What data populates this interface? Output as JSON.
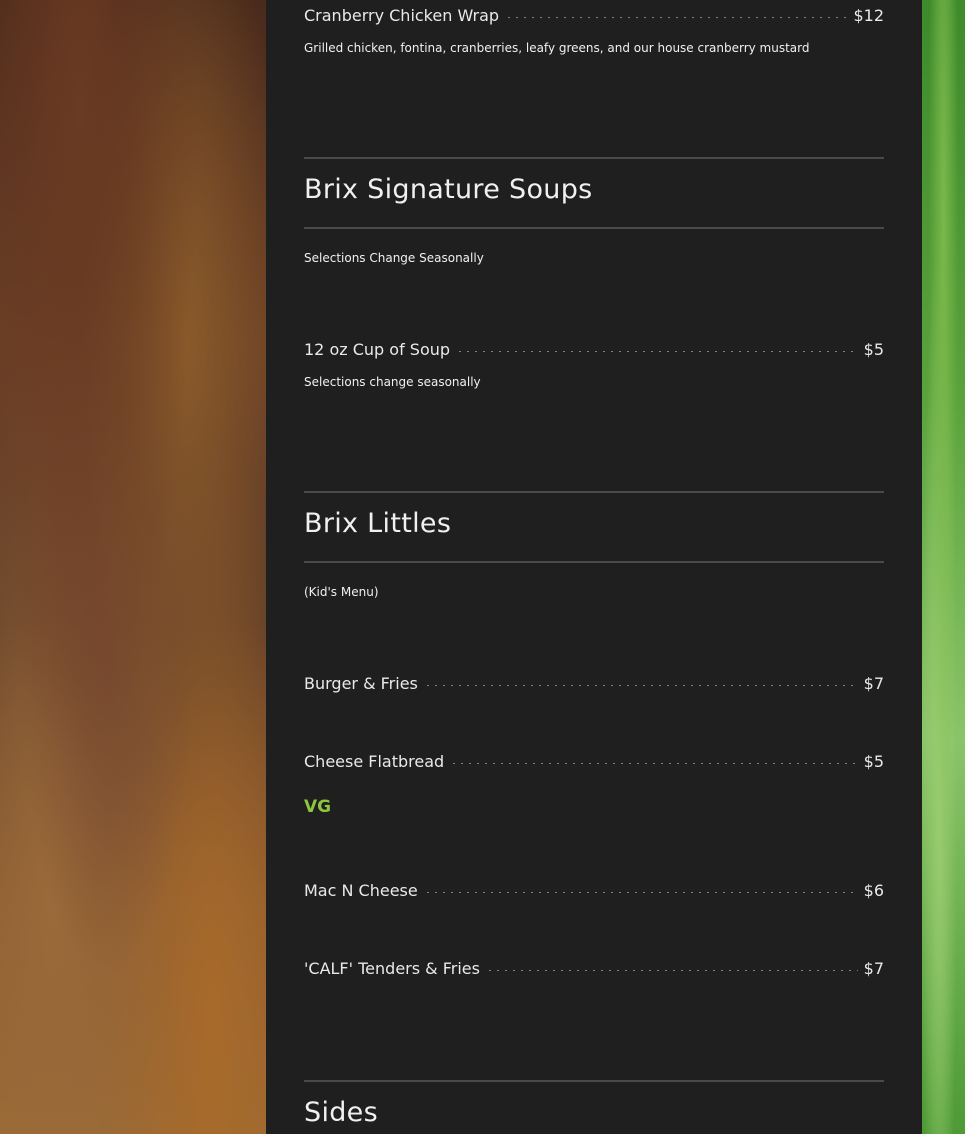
{
  "sections": {
    "wraps_tail": {
      "items": [
        {
          "name": "Cranberry Chicken Wrap",
          "price": "$12",
          "description": "Grilled chicken, fontina, cranberries, leafy greens, and our house cranberry mustard"
        }
      ]
    },
    "soups": {
      "title": "Brix Signature Soups",
      "subtitle": "Selections Change Seasonally",
      "items": [
        {
          "name": "12 oz Cup of Soup",
          "price": "$5",
          "description": "Selections change seasonally"
        }
      ]
    },
    "littles": {
      "title": "Brix Littles",
      "subtitle": "(Kid's Menu)",
      "items": [
        {
          "name": "Burger & Fries",
          "price": "$7"
        },
        {
          "name": "Cheese Flatbread",
          "price": "$5",
          "badge": "VG"
        },
        {
          "name": "Mac N Cheese",
          "price": "$6"
        },
        {
          "name": "'CALF' Tenders & Fries",
          "price": "$7"
        }
      ]
    },
    "sides": {
      "title": "Sides"
    }
  },
  "colors": {
    "panel": "#1f1f1f",
    "text": "#e9e9e9",
    "badge": "#8dc63f",
    "rule": "#4a4a4a"
  }
}
